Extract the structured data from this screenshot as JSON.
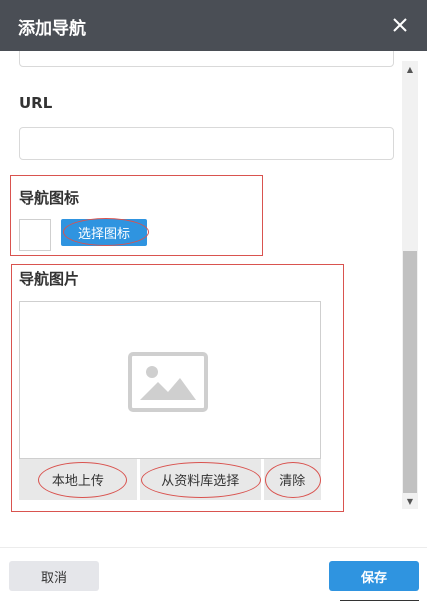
{
  "dialog": {
    "title": "添加导航",
    "close_icon": "close-icon"
  },
  "form": {
    "url_label": "URL",
    "url_value": "",
    "icon_section_label": "导航图标",
    "select_icon_label": "选择图标",
    "image_section_label": "导航图片",
    "image_placeholder_icon": "image-placeholder-icon",
    "upload_local_label": "本地上传",
    "choose_from_library_label": "从资料库选择",
    "clear_label": "清除"
  },
  "footer": {
    "cancel_label": "取消",
    "save_label": "保存"
  },
  "colors": {
    "header_bg": "#4a4e55",
    "primary": "#2f94e0",
    "annotation": "#d9534f",
    "secondary_bg": "#e5e6ea"
  }
}
